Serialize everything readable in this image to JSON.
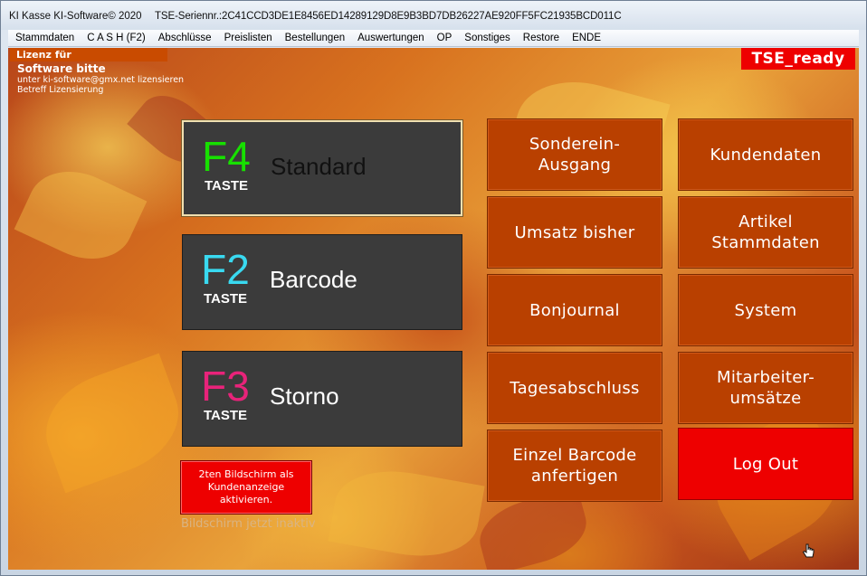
{
  "window": {
    "title": "KI Kasse KI-Software© 2020",
    "serial": "TSE-Seriennr.:2C41CCD3DE1E8456ED14289129D8E9B3BD7DB26227AE920FF5FC21935BCD011C"
  },
  "menu": [
    "Stammdaten",
    "C A S H (F2)",
    "Abschlüsse",
    "Preislisten",
    "Bestellungen",
    "Auswertungen",
    "OP",
    "Sonstiges",
    "Restore",
    "ENDE"
  ],
  "license": {
    "header": "Lizenz für",
    "line1": "Software bitte",
    "line2": "unter ki-software@gmx.net lizensieren",
    "line3": "Betreff Lizensierung"
  },
  "tse_status": "TSE_ready",
  "function_keys": [
    {
      "key": "F4",
      "taste": "TASTE",
      "label": "Standard",
      "key_color": "#17e000"
    },
    {
      "key": "F2",
      "taste": "TASTE",
      "label": "Barcode",
      "key_color": "#39d9f0"
    },
    {
      "key": "F3",
      "taste": "TASTE",
      "label": "Storno",
      "key_color": "#e8237a"
    }
  ],
  "tiles_middle": [
    "Sonderein-\nAusgang",
    "Umsatz bisher",
    "Bonjournal",
    "Tagesabschluss",
    "Einzel Barcode\nanfertigen"
  ],
  "tiles_right": [
    "Kundendaten",
    "Artikel\nStammdaten",
    "System",
    "Mitarbeiter-\numsätze",
    "Log Out"
  ],
  "second_screen": {
    "button_label": "2ten Bildschirm als\nKundenanzeige\naktivieren.",
    "status": "Bildschirm jetzt inaktiv"
  },
  "colors": {
    "tile": "#b94000",
    "logout": "#ee0000",
    "tse_badge": "#ee0000",
    "fkey_bg": "#3b3b3b"
  }
}
